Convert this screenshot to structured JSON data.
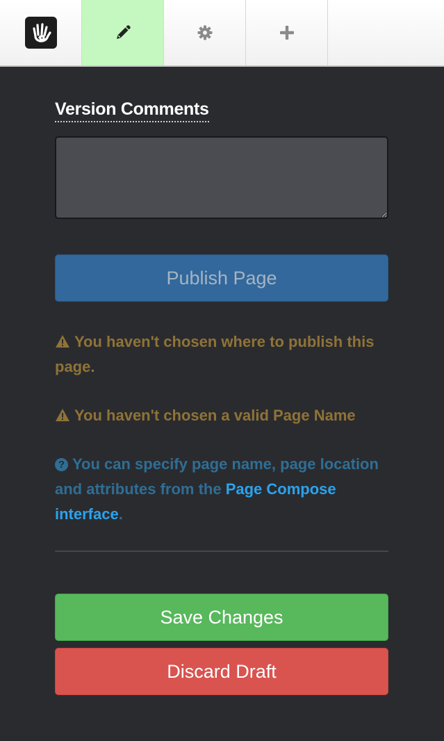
{
  "toolbar": {
    "logo_icon": "concrete5-hand-logo-icon",
    "items": [
      {
        "icon": "pencil-icon",
        "active": true
      },
      {
        "icon": "gear-icon",
        "active": false
      },
      {
        "icon": "plus-icon",
        "active": false
      }
    ],
    "active_color": "#c4f8c0"
  },
  "panel": {
    "version_comments_label": "Version Comments",
    "version_comments_value": "",
    "publish_label": "Publish Page",
    "warnings": [
      "You haven't chosen where to publish this page.",
      "You haven't chosen a valid Page Name"
    ],
    "info_text_before": "You can specify page name, page location and attributes from the ",
    "info_link": "Page Compose interface",
    "info_text_after": ".",
    "save_label": "Save Changes",
    "discard_label": "Discard Draft"
  },
  "colors": {
    "background": "#2a2b2f",
    "publish": "#32689b",
    "save": "#58b85c",
    "discard": "#d9534f",
    "warning_text": "#8f7337",
    "info_text": "#2f6e95",
    "link": "#2aa3ee"
  }
}
